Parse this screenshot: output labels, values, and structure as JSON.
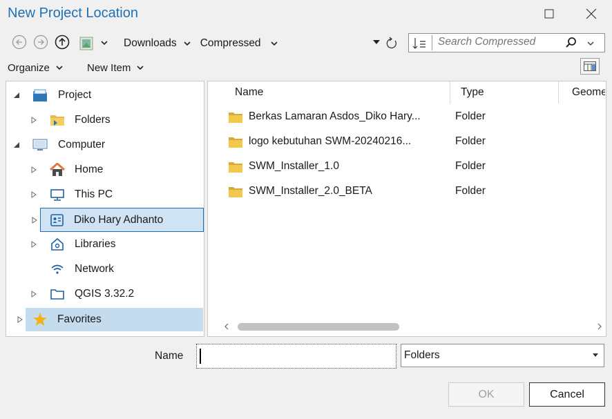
{
  "window": {
    "title": "New Project Location"
  },
  "address": {
    "crumbs": [
      "Downloads",
      "Compressed"
    ]
  },
  "search": {
    "placeholder": "Search Compressed"
  },
  "menu": {
    "organize": "Organize",
    "new_item": "New Item"
  },
  "tree": [
    {
      "label": "Project",
      "icon": "project-icon",
      "expanded": true
    },
    {
      "label": "Folders",
      "icon": "folder-icon",
      "expanded": false
    },
    {
      "label": "Computer",
      "icon": "computer-icon",
      "expanded": true
    },
    {
      "label": "Home",
      "icon": "home-icon",
      "expanded": false
    },
    {
      "label": "This PC",
      "icon": "monitor-icon",
      "expanded": false
    },
    {
      "label": "Diko Hary Adhanto",
      "icon": "user-card-icon",
      "expanded": false,
      "selected": true
    },
    {
      "label": "Libraries",
      "icon": "library-icon",
      "expanded": false
    },
    {
      "label": "Network",
      "icon": "network-icon"
    },
    {
      "label": "QGIS 3.32.2",
      "icon": "folder-outline-icon",
      "expanded": false
    },
    {
      "label": "Favorites",
      "icon": "star-icon",
      "expanded": false
    }
  ],
  "columns": {
    "name": "Name",
    "type": "Type",
    "geom": "Geome"
  },
  "files": [
    {
      "name": "Berkas Lamaran Asdos_Diko Hary...",
      "type": "Folder"
    },
    {
      "name": "logo kebutuhan SWM-20240216...",
      "type": "Folder"
    },
    {
      "name": "SWM_Installer_1.0",
      "type": "Folder"
    },
    {
      "name": "SWM_Installer_2.0_BETA",
      "type": "Folder"
    }
  ],
  "form": {
    "name_label": "Name",
    "name_value": "",
    "filter_value": "Folders"
  },
  "buttons": {
    "ok": "OK",
    "cancel": "Cancel"
  },
  "colors": {
    "accent": "#1f6fb5",
    "folder": "#e8b94a",
    "star": "#f2b318",
    "selection": "#c5dcef"
  }
}
